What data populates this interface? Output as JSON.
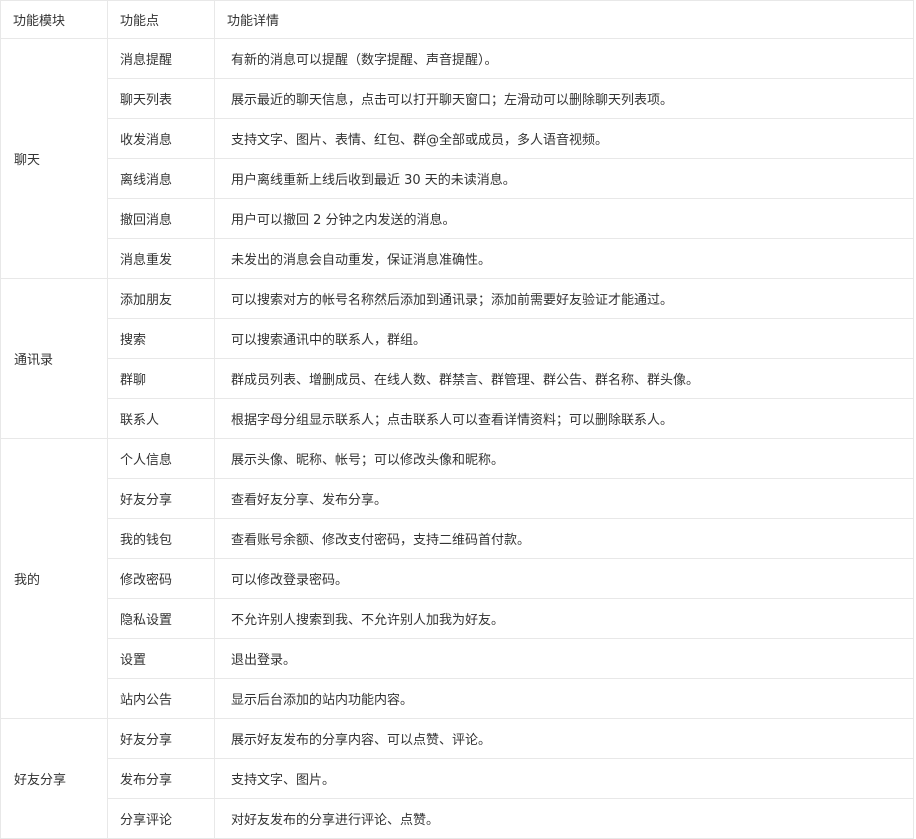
{
  "headers": {
    "module": "功能模块",
    "point": "功能点",
    "detail": "功能详情"
  },
  "groups": [
    {
      "module": "聊天",
      "rows": [
        {
          "point": "消息提醒",
          "detail": "有新的消息可以提醒（数字提醒、声音提醒）。"
        },
        {
          "point": "聊天列表",
          "detail": "展示最近的聊天信息，点击可以打开聊天窗口；左滑动可以删除聊天列表项。"
        },
        {
          "point": "收发消息",
          "detail": "支持文字、图片、表情、红包、群@全部或成员，多人语音视频。"
        },
        {
          "point": "离线消息",
          "detail": "用户离线重新上线后收到最近 30 天的未读消息。"
        },
        {
          "point": "撤回消息",
          "detail": "用户可以撤回 2 分钟之内发送的消息。"
        },
        {
          "point": "消息重发",
          "detail": "未发出的消息会自动重发，保证消息准确性。"
        }
      ]
    },
    {
      "module": "通讯录",
      "rows": [
        {
          "point": "添加朋友",
          "detail": "可以搜索对方的帐号名称然后添加到通讯录；添加前需要好友验证才能通过。"
        },
        {
          "point": "搜索",
          "detail": "可以搜索通讯中的联系人，群组。"
        },
        {
          "point": "群聊",
          "detail": "群成员列表、增删成员、在线人数、群禁言、群管理、群公告、群名称、群头像。"
        },
        {
          "point": "联系人",
          "detail": "根据字母分组显示联系人；点击联系人可以查看详情资料；可以删除联系人。"
        }
      ]
    },
    {
      "module": "我的",
      "rows": [
        {
          "point": "个人信息",
          "detail": "展示头像、昵称、帐号；可以修改头像和昵称。"
        },
        {
          "point": "好友分享",
          "detail": "查看好友分享、发布分享。"
        },
        {
          "point": "我的钱包",
          "detail": "查看账号余额、修改支付密码，支持二维码首付款。"
        },
        {
          "point": "修改密码",
          "detail": "可以修改登录密码。"
        },
        {
          "point": "隐私设置",
          "detail": "不允许别人搜索到我、不允许别人加我为好友。"
        },
        {
          "point": "设置",
          "detail": "退出登录。"
        },
        {
          "point": "站内公告",
          "detail": "显示后台添加的站内功能内容。"
        }
      ]
    },
    {
      "module": "好友分享",
      "rows": [
        {
          "point": "好友分享",
          "detail": "展示好友发布的分享内容、可以点赞、评论。"
        },
        {
          "point": "发布分享",
          "detail": "支持文字、图片。"
        },
        {
          "point": "分享评论",
          "detail": "对好友发布的分享进行评论、点赞。"
        }
      ]
    }
  ]
}
